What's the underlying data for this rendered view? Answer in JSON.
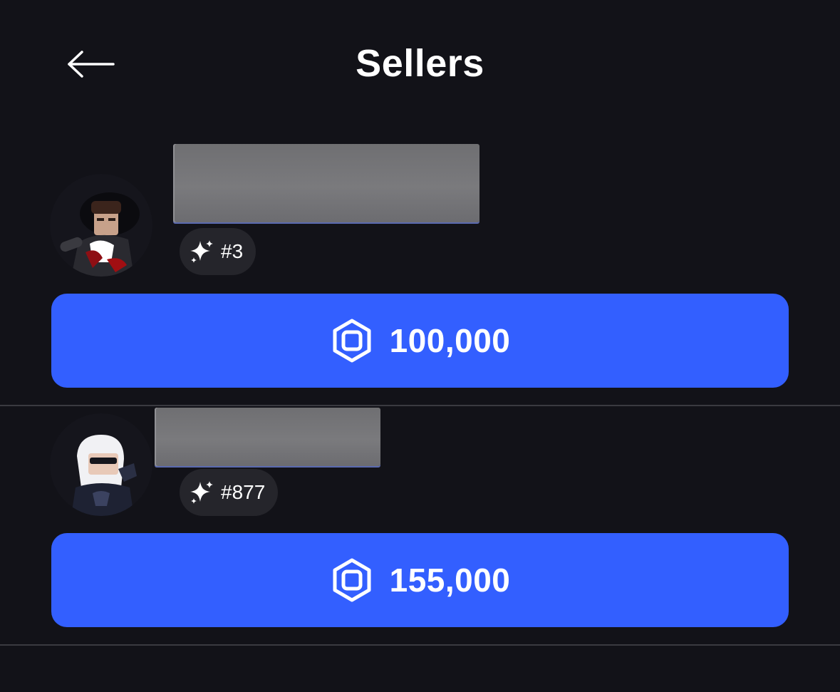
{
  "header": {
    "title": "Sellers",
    "back_icon": "arrow-left-icon"
  },
  "sellers": [
    {
      "rank": "#3",
      "rank_icon": "sparkle-icon",
      "price": "100,000",
      "currency_icon": "robux-icon"
    },
    {
      "rank": "#877",
      "rank_icon": "sparkle-icon",
      "price": "155,000",
      "currency_icon": "robux-icon"
    }
  ],
  "colors": {
    "background": "#121218",
    "button": "#335fff",
    "badge": "#25252b",
    "divider": "#3a3a40",
    "redaction": "#737376"
  }
}
